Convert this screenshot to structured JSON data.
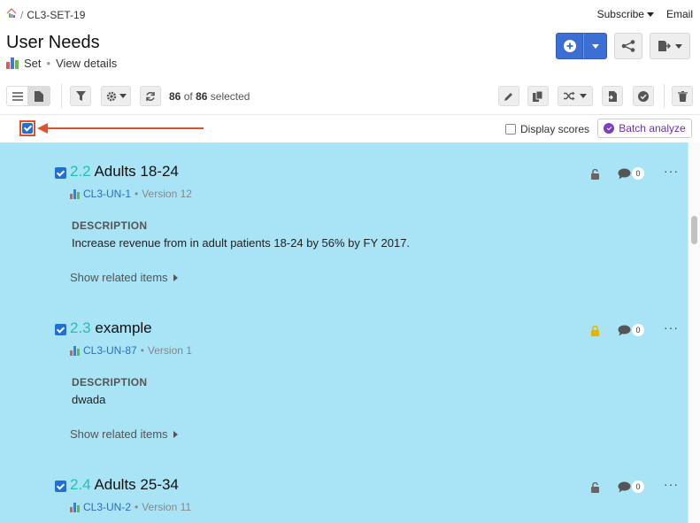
{
  "breadcrumb": {
    "sep": "/",
    "id": "CL3-SET-19"
  },
  "header": {
    "subscribe_label": "Subscribe",
    "email_label": "Email",
    "title": "User Needs",
    "type_label": "Set",
    "view_details": "View details"
  },
  "toolbar": {
    "selected_count": "86",
    "total_count": "86",
    "of_label": "of",
    "selected_label": "selected"
  },
  "selbar": {
    "display_scores_label": "Display scores",
    "batch_analyze_label": "Batch analyze"
  },
  "items": [
    {
      "number": "2.2",
      "name": "Adults 18-24",
      "key": "CL3-UN-1",
      "version": "Version 12",
      "desc_heading": "DESCRIPTION",
      "description": "Increase revenue from in adult patients 18-24 by 56% by FY 2017.",
      "related": "Show related items",
      "comments": "0",
      "locked": false
    },
    {
      "number": "2.3",
      "name": "example",
      "key": "CL3-UN-87",
      "version": "Version 1",
      "desc_heading": "DESCRIPTION",
      "description": "dwada",
      "related": "Show related items",
      "comments": "0",
      "locked": true
    },
    {
      "number": "2.4",
      "name": "Adults 25-34",
      "key": "CL3-UN-2",
      "version": "Version 11",
      "comments": "0",
      "locked": false
    }
  ],
  "colors": {
    "accent_blue": "#3c6fd4",
    "highlight_bg": "#a8e3f6",
    "item_number": "#23c1b3",
    "callout": "#e0502b",
    "lock_locked": "#e8b400"
  }
}
